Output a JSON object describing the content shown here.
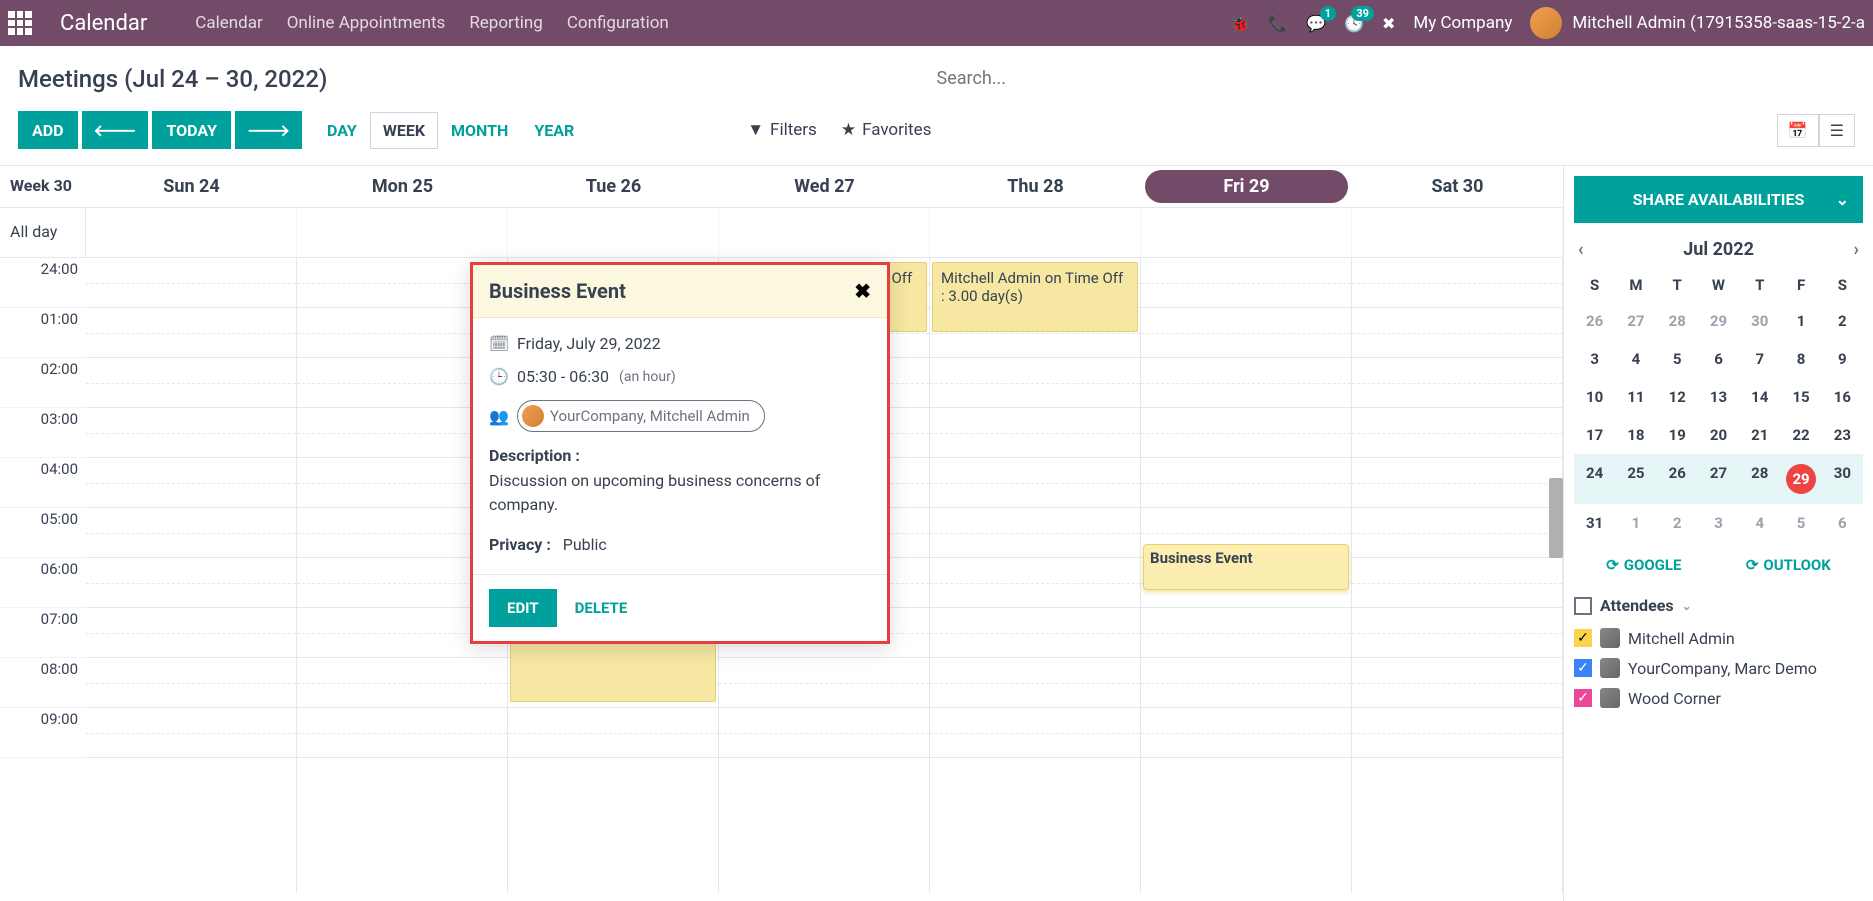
{
  "topbar": {
    "app_title": "Calendar",
    "menu": [
      "Calendar",
      "Online Appointments",
      "Reporting",
      "Configuration"
    ],
    "badge_msg": "1",
    "badge_activity": "39",
    "company": "My Company",
    "user": "Mitchell Admin (17915358-saas-15-2-a"
  },
  "title_row": {
    "title": "Meetings (Jul 24 – 30, 2022)",
    "search_placeholder": "Search..."
  },
  "toolbar": {
    "add": "ADD",
    "today": "TODAY",
    "views": {
      "day": "DAY",
      "week": "WEEK",
      "month": "MONTH",
      "year": "YEAR"
    },
    "filters": "Filters",
    "favorites": "Favorites"
  },
  "cal_header": {
    "week": "Week 30",
    "days": [
      "Sun 24",
      "Mon 25",
      "Tue 26",
      "Wed 27",
      "Thu 28",
      "Fri 29",
      "Sat 30"
    ],
    "today_index": 5,
    "all_day": "All day"
  },
  "time_labels": [
    "24:00",
    "01:00",
    "02:00",
    "03:00",
    "04:00",
    "05:00",
    "06:00",
    "07:00",
    "08:00",
    "09:00"
  ],
  "events": {
    "timeoff": "Mitchell Admin on Time Off : 3.00 day(s)",
    "business": "Business Event"
  },
  "popover": {
    "title": "Business Event",
    "date": "Friday, July 29, 2022",
    "time": "05:30 - 06:30",
    "duration": "(an hour)",
    "attendee": "YourCompany, Mitchell Admin",
    "desc_label": "Description :",
    "desc_text": "Discussion on upcoming business concerns of company.",
    "privacy_label": "Privacy :",
    "privacy_value": "Public",
    "edit": "EDIT",
    "delete": "DELETE"
  },
  "sidebar": {
    "share": "SHARE AVAILABILITIES",
    "month_title": "Jul 2022",
    "dow": [
      "S",
      "M",
      "T",
      "W",
      "T",
      "F",
      "S"
    ],
    "weeks": [
      [
        {
          "d": "26",
          "o": true
        },
        {
          "d": "27",
          "o": true
        },
        {
          "d": "28",
          "o": true
        },
        {
          "d": "29",
          "o": true
        },
        {
          "d": "30",
          "o": true
        },
        {
          "d": "1"
        },
        {
          "d": "2"
        }
      ],
      [
        {
          "d": "3"
        },
        {
          "d": "4"
        },
        {
          "d": "5"
        },
        {
          "d": "6"
        },
        {
          "d": "7"
        },
        {
          "d": "8"
        },
        {
          "d": "9"
        }
      ],
      [
        {
          "d": "10"
        },
        {
          "d": "11"
        },
        {
          "d": "12"
        },
        {
          "d": "13"
        },
        {
          "d": "14"
        },
        {
          "d": "15"
        },
        {
          "d": "16"
        }
      ],
      [
        {
          "d": "17"
        },
        {
          "d": "18"
        },
        {
          "d": "19"
        },
        {
          "d": "20"
        },
        {
          "d": "21"
        },
        {
          "d": "22"
        },
        {
          "d": "23"
        }
      ],
      [
        {
          "d": "24",
          "cw": true
        },
        {
          "d": "25",
          "cw": true
        },
        {
          "d": "26",
          "cw": true
        },
        {
          "d": "27",
          "cw": true
        },
        {
          "d": "28",
          "cw": true
        },
        {
          "d": "29",
          "cw": true,
          "t": true
        },
        {
          "d": "30",
          "cw": true
        }
      ],
      [
        {
          "d": "31"
        },
        {
          "d": "1",
          "o": true
        },
        {
          "d": "2",
          "o": true
        },
        {
          "d": "3",
          "o": true
        },
        {
          "d": "4",
          "o": true
        },
        {
          "d": "5",
          "o": true
        },
        {
          "d": "6",
          "o": true
        }
      ]
    ],
    "sync_google": "GOOGLE",
    "sync_outlook": "OUTLOOK",
    "attendees_label": "Attendees",
    "attendees": [
      {
        "name": "Mitchell Admin",
        "checkClass": "checked-yellow"
      },
      {
        "name": "YourCompany, Marc Demo",
        "checkClass": "checked-blue"
      },
      {
        "name": "Wood Corner",
        "checkClass": "checked-pink"
      }
    ]
  }
}
